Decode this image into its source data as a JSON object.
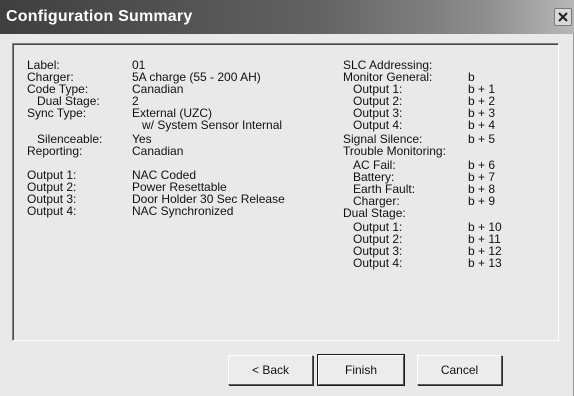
{
  "window": {
    "title": "Configuration Summary",
    "close_icon": "close-icon"
  },
  "summary": {
    "left": [
      {
        "label": "Label:",
        "value": "01"
      },
      {
        "label": "Charger:",
        "value": "5A charge (55 - 200 AH)"
      },
      {
        "label": "Code Type:",
        "value": "Canadian"
      },
      {
        "label": "Dual Stage:",
        "value": "2"
      },
      {
        "label": "Sync Type:",
        "value": "External (UZC)"
      },
      {
        "label": "",
        "value": "w/ System Sensor Internal"
      },
      {
        "label": "Silenceable:",
        "value": "Yes"
      },
      {
        "label": "Reporting:",
        "value": "Canadian"
      },
      {
        "label": "Output 1:",
        "value": "NAC Coded"
      },
      {
        "label": "Output 2:",
        "value": "Power Resettable"
      },
      {
        "label": "Output 3:",
        "value": "Door Holder 30 Sec Release"
      },
      {
        "label": "Output 4:",
        "value": "NAC Synchronized"
      }
    ],
    "right": [
      {
        "label": "SLC Addressing:",
        "value": ""
      },
      {
        "label": "Monitor General:",
        "value": "b"
      },
      {
        "label": "Output 1:",
        "value": "b + 1"
      },
      {
        "label": "Output 2:",
        "value": "b + 2"
      },
      {
        "label": "Output 3:",
        "value": "b + 3"
      },
      {
        "label": "Output 4:",
        "value": "b + 4"
      },
      {
        "label": "Signal Silence:",
        "value": "b + 5"
      },
      {
        "label": "Trouble Monitoring:",
        "value": ""
      },
      {
        "label": "AC Fail:",
        "value": "b + 6"
      },
      {
        "label": "Battery:",
        "value": "b + 7"
      },
      {
        "label": "Earth Fault:",
        "value": "b + 8"
      },
      {
        "label": "Charger:",
        "value": "b + 9"
      },
      {
        "label": "Dual Stage:",
        "value": ""
      },
      {
        "label": "Output 1:",
        "value": "b + 10"
      },
      {
        "label": "Output 2:",
        "value": "b + 11"
      },
      {
        "label": "Output 3:",
        "value": "b + 12"
      },
      {
        "label": "Output 4:",
        "value": "b + 13"
      }
    ]
  },
  "buttons": {
    "back": "< Back",
    "finish": "Finish",
    "cancel": "Cancel"
  }
}
